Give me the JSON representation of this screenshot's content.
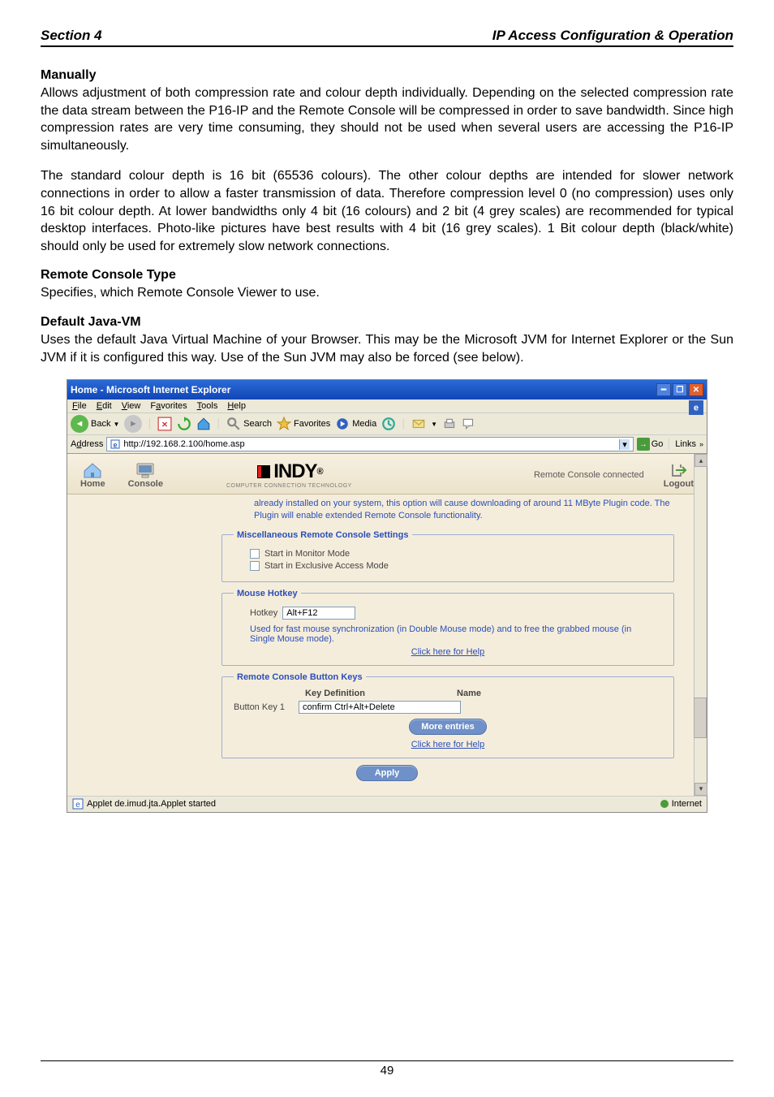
{
  "header": {
    "left": "Section 4",
    "right": "IP Access Configuration & Operation"
  },
  "doc": {
    "h1": "Manually",
    "p1": "Allows adjustment of both compression rate and colour depth individually. Depending on the selected compression rate the data stream between the P16-IP and the Remote Console will be compressed in order to save bandwidth. Since high compression rates are very time consuming, they should not be used when several users are accessing the P16-IP simultaneously.",
    "p2": "The standard colour depth is 16 bit (65536 colours). The other colour depths are intended for slower network connections in order to allow a faster transmission of data. Therefore compression level 0 (no compression) uses only 16 bit colour depth. At lower bandwidths only 4 bit (16 colours) and 2 bit (4 grey scales) are recommended for typical desktop interfaces. Photo-like pictures have best results with 4 bit (16 grey scales). 1 Bit colour depth (black/white) should only be used for extremely slow network connections.",
    "h2": "Remote Console Type",
    "p3": "Specifies, which Remote Console Viewer to use.",
    "h3": "Default Java-VM",
    "p4": "Uses the default Java Virtual Machine of your Browser. This may be the Microsoft JVM for Internet Explorer or the Sun JVM if it is configured this way. Use of the Sun JVM may also be forced (see below)."
  },
  "ss": {
    "title": "Home - Microsoft Internet Explorer",
    "menus": {
      "file": "File",
      "edit": "Edit",
      "view": "View",
      "favorites": "Favorites",
      "tools": "Tools",
      "help": "Help"
    },
    "toolbar": {
      "back": "Back",
      "search": "Search",
      "favorites": "Favorites",
      "media": "Media"
    },
    "address_label": "Address",
    "address_value": "http://192.168.2.100/home.asp",
    "go": "Go",
    "links": "Links",
    "nav": {
      "home": "Home",
      "console": "Console"
    },
    "brand_sub": "COMPUTER CONNECTION TECHNOLOGY",
    "status_right": "Remote Console connected",
    "logout": "Logout",
    "info_blurb": "already installed on your system, this option will cause downloading of around 11 MByte Plugin code. The Plugin will enable extended Remote Console functionality.",
    "fs_misc": {
      "legend": "Miscellaneous Remote Console Settings",
      "opt1": "Start in Monitor Mode",
      "opt2": "Start in Exclusive Access Mode"
    },
    "fs_hotkey": {
      "legend": "Mouse Hotkey",
      "label": "Hotkey",
      "value": "Alt+F12",
      "desc": "Used for fast mouse synchronization (in Double Mouse mode) and to free the grabbed mouse (in Single Mouse mode).",
      "help": "Click here for Help"
    },
    "fs_keys": {
      "legend": "Remote Console Button Keys",
      "col1": "Key Definition",
      "col2": "Name",
      "row_label": "Button Key 1",
      "row_value": "confirm Ctrl+Alt+Delete",
      "more": "More entries",
      "help": "Click here for Help"
    },
    "apply": "Apply",
    "status_text": "Applet de.imud.jta.Applet started",
    "status_zone": "Internet"
  },
  "footer_page": "49"
}
